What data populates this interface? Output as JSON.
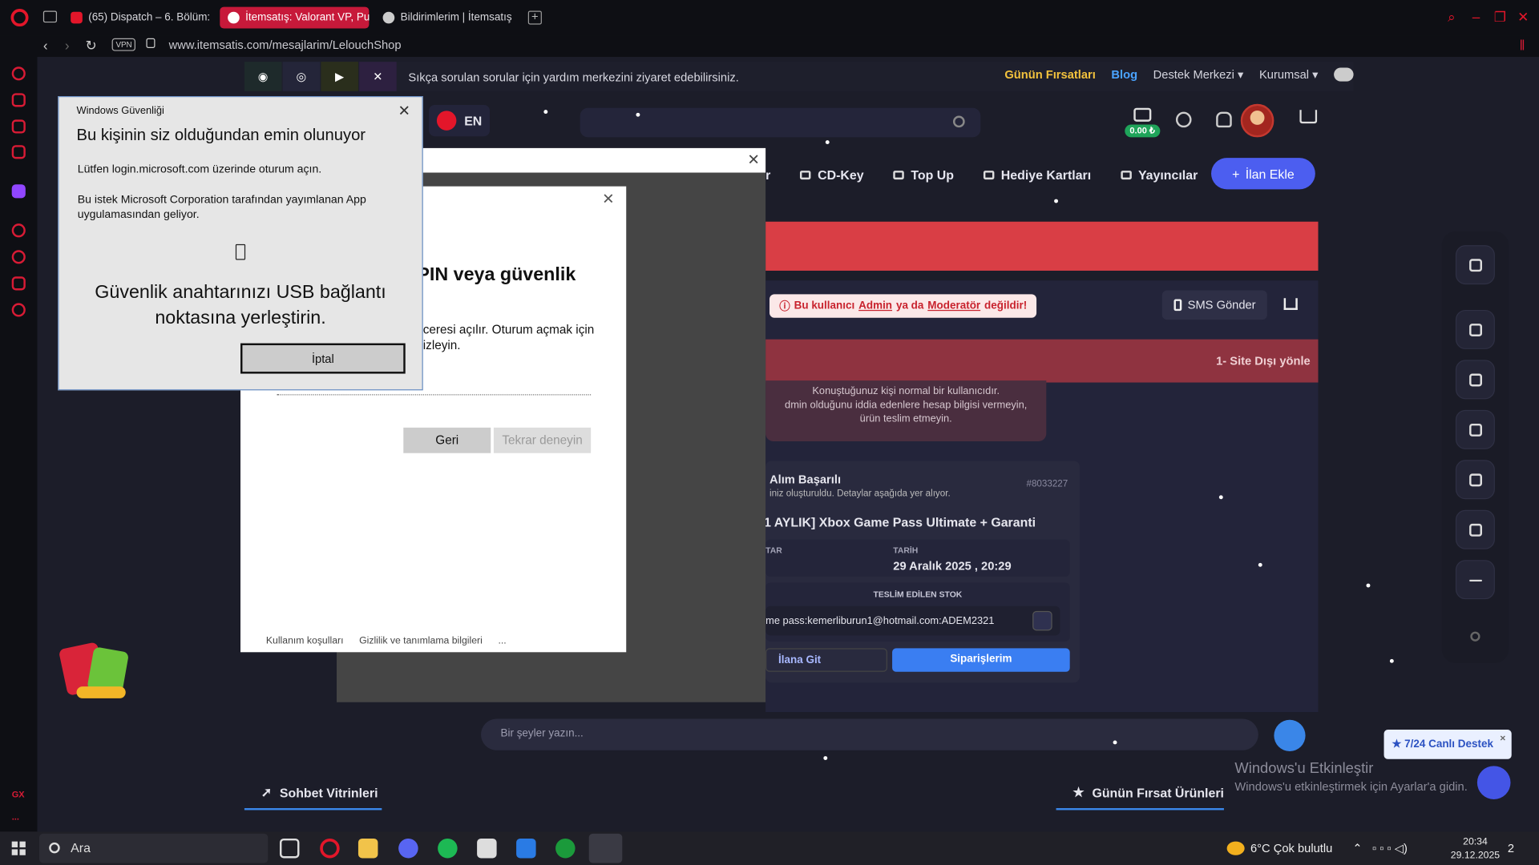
{
  "browser": {
    "tabs": [
      {
        "label": "(65) Dispatch – 6. Bölüm: I",
        "active": false
      },
      {
        "label": "İtemsatış: Valorant VP, Pub",
        "active": true
      },
      {
        "label": "Bildirimlerim | İtemsatış",
        "active": false
      }
    ],
    "new_tab": "+",
    "vpn": "VPN",
    "url": "www.itemsatis.com/mesajlarim/LelouchShop",
    "sidebar_label": "GX",
    "sidebar_more": "..."
  },
  "site": {
    "help_text": "Sıkça sorulan sorular için yardım merkezini ziyaret edebilirsiniz.",
    "top_links": {
      "deals": "Günün Fırsatları",
      "blog": "Blog",
      "support_center": "Destek Merkezi",
      "corporate": "Kurumsal"
    },
    "lang": "EN",
    "wallet_balance": "0.00 ₺",
    "menu": [
      "r",
      "CD-Key",
      "Top Up",
      "Hediye Kartları",
      "Yayıncılar"
    ],
    "add_listing": "İlan Ekle",
    "warning": {
      "pre": "Bu kullanıcı",
      "admin": "Admin",
      "mid": "ya da",
      "mod": "Moderatör",
      "post": "değildir!"
    },
    "sms_button": "SMS Gönder",
    "info_bar": "1- Site Dışı yönle",
    "bubble": {
      "l1": "Konuştuğunuz kişi normal bir kullanıcıdır.",
      "l2": "dmin olduğunu iddia edenlere hesap bilgisi vermeyin,",
      "l3": "ürün teslim etmeyin."
    },
    "order": {
      "title1": "Alım Başarılı",
      "title2": "iniz oluşturuldu. Detaylar aşağıda yer alıyor.",
      "id": "#8033227",
      "product": "[1 AYLIK] Xbox Game Pass Ultimate + Garanti",
      "label_amount": "TAR",
      "label_date": "TARİH",
      "date": "29 Aralık 2025 , 20:29",
      "stock_label": "TESLİM EDİLEN STOK",
      "stock": "me pass:kemerliburun1@hotmail.com:ADEM2321",
      "go_listing": "İlana Git",
      "my_orders": "Siparişlerim"
    },
    "chat_placeholder": "Bir şeyler yazın...",
    "showcase": "Sohbet Vitrinleri",
    "deal_products": "Günün Fırsat Ürünleri",
    "live_support": "★ 7/24 Canlı Destek",
    "live_support_close": "×"
  },
  "win_activate": {
    "title": "Windows'u Etkinleştir",
    "sub": "Windows'u etkinleştirmek için Ayarlar'a gidin."
  },
  "ms_dialog": {
    "heading": "PIN veya güvenlik",
    "p1": "ceresi açılır. Oturum açmak için",
    "p2": "izleyin.",
    "back": "Geri",
    "retry": "Tekrar deneyin",
    "terms": "Kullanım koşulları",
    "privacy": "Gizlilik ve tanımlama bilgileri",
    "more": "..."
  },
  "win_security": {
    "caption": "Windows Güvenliği",
    "heading": "Bu kişinin siz olduğundan emin olunuyor",
    "line1": "Lütfen login.microsoft.com üzerinde oturum açın.",
    "line2": "Bu istek Microsoft Corporation tarafından yayımlanan App uygulamasından geliyor.",
    "big1": "Güvenlik anahtarınızı USB bağlantı",
    "big2": "noktasına yerleştirin.",
    "cancel": "İptal"
  },
  "taskbar": {
    "search": "Ara",
    "weather": "6°C  Çok bulutlu",
    "time": "20:34",
    "date": "29.12.2025",
    "notif": "2"
  },
  "colors": {
    "opera_red": "#e3162a",
    "accent_blue": "#3a86e8",
    "banner_red": "#d93e45"
  }
}
